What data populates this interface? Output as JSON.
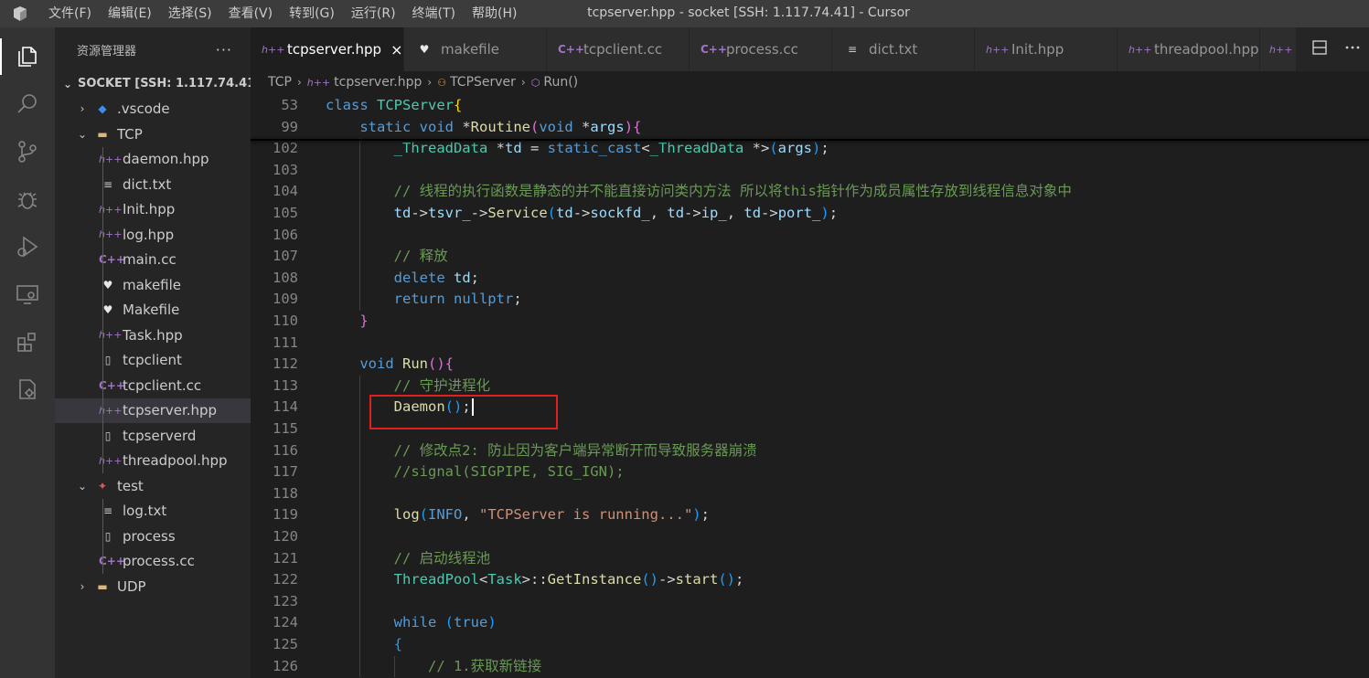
{
  "window": {
    "title": "tcpserver.hpp - socket [SSH: 1.117.74.41] - Cursor",
    "menu": [
      "文件(F)",
      "编辑(E)",
      "选择(S)",
      "查看(V)",
      "转到(G)",
      "运行(R)",
      "终端(T)",
      "帮助(H)"
    ]
  },
  "activitybar": {
    "items": [
      "explorer-icon",
      "search-icon",
      "source-control-icon",
      "debug-icon",
      "run-debug-icon",
      "remote-explorer-icon",
      "extensions-icon",
      "remote-settings-icon"
    ]
  },
  "sidebar": {
    "title": "资源管理器",
    "more": "···",
    "root": "SOCKET [SSH: 1.117.74.41]",
    "items": [
      {
        "label": ".vscode",
        "type": "folder-vscode",
        "depth": 1,
        "chevron": "›"
      },
      {
        "label": "TCP",
        "type": "folder",
        "depth": 1,
        "chevron": "⌄"
      },
      {
        "label": "daemon.hpp",
        "type": "hpp",
        "depth": 2
      },
      {
        "label": "dict.txt",
        "type": "txt",
        "depth": 2
      },
      {
        "label": "Init.hpp",
        "type": "hpp",
        "depth": 2
      },
      {
        "label": "log.hpp",
        "type": "hpp",
        "depth": 2
      },
      {
        "label": "main.cc",
        "type": "cc",
        "depth": 2
      },
      {
        "label": "makefile",
        "type": "make",
        "depth": 2
      },
      {
        "label": "Makefile",
        "type": "make",
        "depth": 2
      },
      {
        "label": "Task.hpp",
        "type": "hpp",
        "depth": 2
      },
      {
        "label": "tcpclient",
        "type": "file",
        "depth": 2
      },
      {
        "label": "tcpclient.cc",
        "type": "cc",
        "depth": 2
      },
      {
        "label": "tcpserver.hpp",
        "type": "hpp",
        "depth": 2,
        "selected": true
      },
      {
        "label": "tcpserverd",
        "type": "file",
        "depth": 2
      },
      {
        "label": "threadpool.hpp",
        "type": "hpp",
        "depth": 2
      },
      {
        "label": "test",
        "type": "folder-test",
        "depth": 1,
        "chevron": "⌄"
      },
      {
        "label": "log.txt",
        "type": "txt",
        "depth": 2
      },
      {
        "label": "process",
        "type": "file",
        "depth": 2
      },
      {
        "label": "process.cc",
        "type": "cc",
        "depth": 2
      },
      {
        "label": "UDP",
        "type": "folder",
        "depth": 1,
        "chevron": "›"
      }
    ]
  },
  "tabs": [
    {
      "label": "tcpserver.hpp",
      "type": "hpp",
      "active": true,
      "close": "×"
    },
    {
      "label": "makefile",
      "type": "make"
    },
    {
      "label": "tcpclient.cc",
      "type": "cc"
    },
    {
      "label": "process.cc",
      "type": "cc"
    },
    {
      "label": "dict.txt",
      "type": "txt"
    },
    {
      "label": "Init.hpp",
      "type": "hpp"
    },
    {
      "label": "threadpool.hpp",
      "type": "hpp"
    },
    {
      "label": "",
      "type": "hpp"
    }
  ],
  "tab_actions": [
    "split-editor-icon",
    "more-actions-icon"
  ],
  "breadcrumb": [
    "TCP",
    "tcpserver.hpp",
    "TCPServer",
    "Run()"
  ],
  "icons": {
    "hpp": "h++",
    "cc": "C++",
    "txt": "≡",
    "make": "♥",
    "file": "▯",
    "folder": "▬",
    "folder-vscode": "◆",
    "folder-test": "✦"
  },
  "editor": {
    "lines": [
      {
        "n": "53",
        "tokens": [
          [
            "kw",
            "class "
          ],
          [
            "ty",
            "TCPServer"
          ],
          [
            "br1",
            "{"
          ]
        ]
      },
      {
        "n": "99",
        "tokens": [
          [
            "",
            "    "
          ],
          [
            "kw",
            "static "
          ],
          [
            "kw",
            "void "
          ],
          [
            "",
            "*"
          ],
          [
            "fn",
            "Routine"
          ],
          [
            "br2",
            "("
          ],
          [
            "kw",
            "void "
          ],
          [
            "",
            "*"
          ],
          [
            "var",
            "args"
          ],
          [
            "br2",
            ")"
          ],
          [
            "br2",
            "{"
          ]
        ]
      },
      {
        "n": "102",
        "tokens": [
          [
            "",
            "        "
          ],
          [
            "ty",
            "_ThreadData "
          ],
          [
            "",
            "*"
          ],
          [
            "var",
            "td"
          ],
          [
            "",
            " = "
          ],
          [
            "kw",
            "static_cast"
          ],
          [
            "",
            "<"
          ],
          [
            "ty",
            "_ThreadData "
          ],
          [
            "",
            "*>"
          ],
          [
            "br3",
            "("
          ],
          [
            "var",
            "args"
          ],
          [
            "br3",
            ")"
          ],
          [
            ";",
            ";"
          ]
        ]
      },
      {
        "n": "103",
        "tokens": []
      },
      {
        "n": "104",
        "tokens": [
          [
            "",
            "        "
          ],
          [
            "cm",
            "// 线程的执行函数是静态的并不能直接访问类内方法 所以将this指针作为成员属性存放到线程信息对象中"
          ]
        ]
      },
      {
        "n": "105",
        "tokens": [
          [
            "",
            "        "
          ],
          [
            "var",
            "td"
          ],
          [
            "",
            "->"
          ],
          [
            "var",
            "tsvr_"
          ],
          [
            "",
            "->"
          ],
          [
            "fn",
            "Service"
          ],
          [
            "br3",
            "("
          ],
          [
            "var",
            "td"
          ],
          [
            "",
            "->"
          ],
          [
            "var",
            "sockfd_"
          ],
          [
            "",
            ", "
          ],
          [
            "var",
            "td"
          ],
          [
            "",
            "->"
          ],
          [
            "var",
            "ip_"
          ],
          [
            "",
            ", "
          ],
          [
            "var",
            "td"
          ],
          [
            "",
            "->"
          ],
          [
            "var",
            "port_"
          ],
          [
            "br3",
            ")"
          ],
          [
            "",
            ";"
          ]
        ]
      },
      {
        "n": "106",
        "tokens": []
      },
      {
        "n": "107",
        "tokens": [
          [
            "",
            "        "
          ],
          [
            "cm",
            "// 释放"
          ]
        ]
      },
      {
        "n": "108",
        "tokens": [
          [
            "",
            "        "
          ],
          [
            "kw",
            "delete "
          ],
          [
            "var",
            "td"
          ],
          [
            "",
            ";"
          ]
        ]
      },
      {
        "n": "109",
        "tokens": [
          [
            "",
            "        "
          ],
          [
            "kw",
            "return "
          ],
          [
            "kw",
            "nullptr"
          ],
          [
            "",
            ";"
          ]
        ]
      },
      {
        "n": "110",
        "tokens": [
          [
            "",
            "    "
          ],
          [
            "br2",
            "}"
          ]
        ]
      },
      {
        "n": "111",
        "tokens": []
      },
      {
        "n": "112",
        "tokens": [
          [
            "",
            "    "
          ],
          [
            "kw",
            "void "
          ],
          [
            "fn",
            "Run"
          ],
          [
            "br2",
            "()"
          ],
          [
            "br2",
            "{"
          ]
        ]
      },
      {
        "n": "113",
        "tokens": [
          [
            "",
            "        "
          ],
          [
            "cm",
            "// 守护进程化"
          ]
        ]
      },
      {
        "n": "114",
        "tokens": [
          [
            "",
            "        "
          ],
          [
            "fn",
            "Daemon"
          ],
          [
            "br3",
            "()"
          ],
          [
            "",
            ";"
          ]
        ]
      },
      {
        "n": "115",
        "tokens": []
      },
      {
        "n": "116",
        "tokens": [
          [
            "",
            "        "
          ],
          [
            "cm",
            "// 修改点2: 防止因为客户端异常断开而导致服务器崩溃"
          ]
        ]
      },
      {
        "n": "117",
        "tokens": [
          [
            "",
            "        "
          ],
          [
            "cm",
            "//signal(SIGPIPE, SIG_IGN);"
          ]
        ]
      },
      {
        "n": "118",
        "tokens": []
      },
      {
        "n": "119",
        "tokens": [
          [
            "",
            "        "
          ],
          [
            "fn",
            "log"
          ],
          [
            "br3",
            "("
          ],
          [
            "mac",
            "INFO"
          ],
          [
            "",
            ", "
          ],
          [
            "str",
            "\"TCPServer is running...\""
          ],
          [
            "br3",
            ")"
          ],
          [
            "",
            ";"
          ]
        ]
      },
      {
        "n": "120",
        "tokens": []
      },
      {
        "n": "121",
        "tokens": [
          [
            "",
            "        "
          ],
          [
            "cm",
            "// 启动线程池"
          ]
        ]
      },
      {
        "n": "122",
        "tokens": [
          [
            "",
            "        "
          ],
          [
            "ty",
            "ThreadPool"
          ],
          [
            "",
            "<"
          ],
          [
            "ty",
            "Task"
          ],
          [
            "",
            ">::"
          ],
          [
            "fn",
            "GetInstance"
          ],
          [
            "br3",
            "()"
          ],
          [
            "",
            "->"
          ],
          [
            "fn",
            "start"
          ],
          [
            "br3",
            "()"
          ],
          [
            "",
            ";"
          ]
        ]
      },
      {
        "n": "123",
        "tokens": []
      },
      {
        "n": "124",
        "tokens": [
          [
            "",
            "        "
          ],
          [
            "kw",
            "while "
          ],
          [
            "br3",
            "("
          ],
          [
            "kw",
            "true"
          ],
          [
            "br3",
            ")"
          ]
        ]
      },
      {
        "n": "125",
        "tokens": [
          [
            "",
            "        "
          ],
          [
            "br3",
            "{"
          ]
        ]
      },
      {
        "n": "126",
        "tokens": [
          [
            "",
            "            "
          ],
          [
            "cm",
            "// 1.获取新链接"
          ]
        ]
      }
    ]
  }
}
